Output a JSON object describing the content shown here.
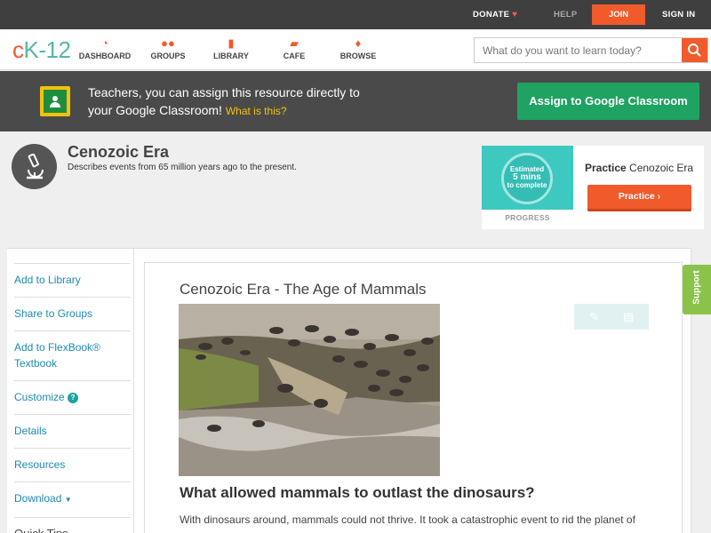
{
  "topbar": {
    "donate": "DONATE",
    "help": "HELP",
    "join": "JOIN",
    "signin": "SIGN IN"
  },
  "nav": {
    "logo_c": "c",
    "logo_rest": "K-12",
    "items": [
      {
        "label": "DASHBOARD",
        "icon": "dashboard-icon"
      },
      {
        "label": "GROUPS",
        "icon": "groups-icon"
      },
      {
        "label": "LIBRARY",
        "icon": "library-icon"
      },
      {
        "label": "CAFE",
        "icon": "cafe-icon"
      },
      {
        "label": "BROWSE",
        "icon": "browse-icon"
      }
    ],
    "search_placeholder": "What do you want to learn today?"
  },
  "banner": {
    "line1": "Teachers, you can assign this resource directly to",
    "line2": "your Google Classroom!",
    "what": "What is this?",
    "assign": "Assign to Google Classroom"
  },
  "concept": {
    "title": "Cenozoic Era",
    "subtitle": "Describes events from 65 million years ago to the present."
  },
  "practice": {
    "estimated": "Estimated",
    "mins": "5 mins",
    "complete": "to complete",
    "progress": "PROGRESS",
    "label_bold": "Practice",
    "label_topic": "Cenozoic Era",
    "button": "Practice"
  },
  "sidebar": {
    "items": [
      {
        "label": "Add to Library"
      },
      {
        "label": "Share to Groups"
      },
      {
        "label": "Add to FlexBook® Textbook"
      },
      {
        "label": "Customize"
      },
      {
        "label": "Details"
      },
      {
        "label": "Resources"
      },
      {
        "label": "Download"
      }
    ],
    "tips": "Quick Tips"
  },
  "article": {
    "title": "Cenozoic Era - The Age of Mammals",
    "question": "What allowed mammals to outlast the dinosaurs?",
    "para": "With dinosaurs around, mammals could not thrive. It took a catastrophic event to rid the planet of"
  },
  "support": "Support",
  "colors": {
    "accent": "#f15a2b",
    "teal": "#57b7a5",
    "green": "#1ea362",
    "link": "#1c8ab0"
  }
}
